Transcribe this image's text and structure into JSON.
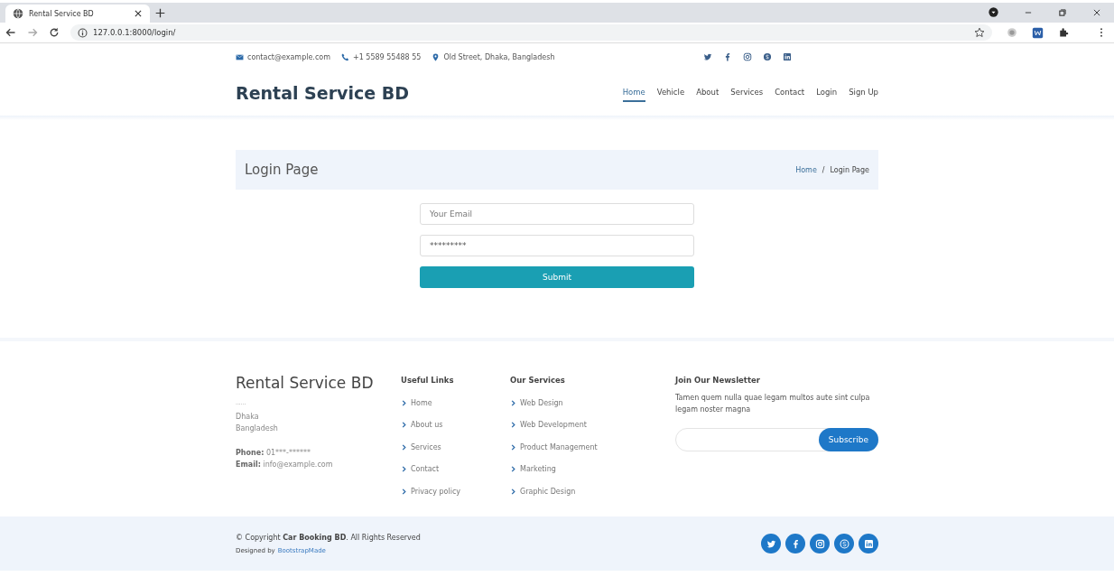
{
  "browser": {
    "tab_title": "Rental Service BD",
    "url": "127.0.0.1:8000/login/"
  },
  "topbar": {
    "email": "contact@example.com",
    "phone": "+1 5589 55488 55",
    "address": "Old Street, Dhaka, Bangladesh"
  },
  "header": {
    "logo": "Rental Service BD",
    "nav": [
      {
        "label": "Home",
        "selected": true
      },
      {
        "label": "Vehicle",
        "selected": false
      },
      {
        "label": "About",
        "selected": false
      },
      {
        "label": "Services",
        "selected": false
      },
      {
        "label": "Contact",
        "selected": false
      },
      {
        "label": "Login",
        "selected": false
      },
      {
        "label": "Sign Up",
        "selected": false
      }
    ]
  },
  "breadcrumb": {
    "title": "Login Page",
    "home": "Home",
    "separator": "/",
    "current": "Login Page"
  },
  "form": {
    "email_placeholder": "Your Email",
    "password_value": "*********",
    "submit": "Submit"
  },
  "footer": {
    "brand": "Rental Service BD",
    "tagline": "......",
    "address_lines": [
      "Dhaka",
      "Bangladesh"
    ],
    "phone_label": "Phone:",
    "phone": "01***-******",
    "email_label": "Email:",
    "email": "info@example.com",
    "columns": [
      {
        "title": "Useful Links",
        "links": [
          "Home",
          "About us",
          "Services",
          "Contact",
          "Privacy policy"
        ]
      },
      {
        "title": "Our Services",
        "links": [
          "Web Design",
          "Web Development",
          "Product Management",
          "Marketing",
          "Graphic Design"
        ]
      }
    ],
    "newsletter": {
      "title": "Join Our Newsletter",
      "text": "Tamen quem nulla quae legam multos aute sint culpa legam noster magna",
      "button": "Subscribe"
    }
  },
  "bottom": {
    "copyright": "© Copyright **Car Booking BD**. All Rights Reserved",
    "designed_by": "Designed by",
    "designer": "BootstrapMade"
  }
}
